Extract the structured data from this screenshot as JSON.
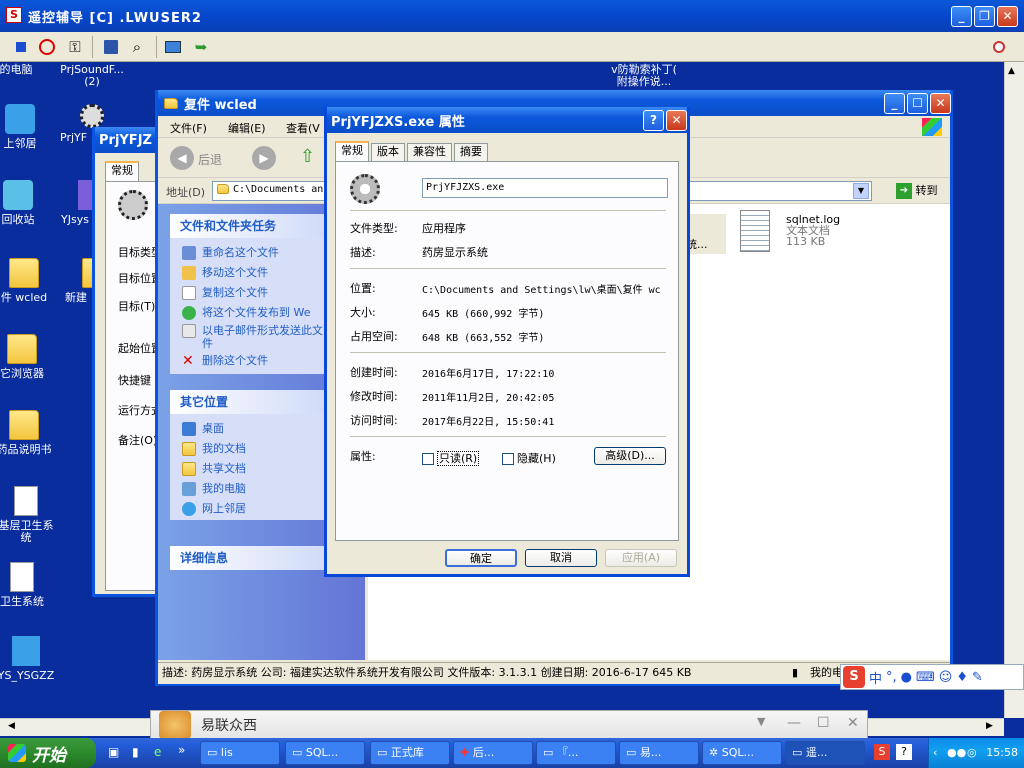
{
  "remote_window": {
    "title": "遥控辅导 [C] .LWUSER2",
    "min": "_",
    "max": "❐",
    "close": "✕"
  },
  "desktop_icons": [
    {
      "label": "的电脑",
      "icon": "computer-icon"
    },
    {
      "label": "PrjSoundF...\n(2)",
      "icon": "gear-icon"
    },
    {
      "label": "上邻居",
      "icon": "network-icon"
    },
    {
      "label": "PrjYF",
      "icon": "gear-icon"
    },
    {
      "label": "回收站",
      "icon": "recycle-icon"
    },
    {
      "label": "YJsys",
      "icon": "app-icon"
    },
    {
      "label": "件 wcled",
      "icon": "folder-icon"
    },
    {
      "label": "新建",
      "icon": "folder-icon"
    },
    {
      "label": "它浏览器",
      "icon": "folder-icon"
    },
    {
      "label": "药品说明书",
      "icon": "folder-icon"
    },
    {
      "label": "基层卫生系统",
      "icon": "shortcut-icon"
    },
    {
      "label": "卫生系统",
      "icon": "shortcut-icon"
    },
    {
      "label": "YS_YSGZZ",
      "icon": "shortcut-icon"
    },
    {
      "label": "v防勒索补丁(\n附操作说...",
      "icon": "doc-icon"
    }
  ],
  "behind_window": {
    "title": "PrjYFJZ",
    "tab": "常规",
    "fields": [
      "目标类型",
      "目标位置",
      "目标(T)",
      "起始位置",
      "快捷键",
      "运行方式",
      "备注(O)"
    ]
  },
  "explorer": {
    "title": "复件 wcled",
    "menu": [
      "文件(F)",
      "编辑(E)",
      "查看(V"
    ],
    "back": "后退",
    "address_label": "地址(D)",
    "address": "C:\\Documents an",
    "go": "转到",
    "tasks_header": "文件和文件夹任务",
    "tasks": [
      {
        "label": "重命名这个文件",
        "icon": "rename-icon"
      },
      {
        "label": "移动这个文件",
        "icon": "move-icon"
      },
      {
        "label": "复制这个文件",
        "icon": "copy-icon"
      },
      {
        "label": "将这个文件发布到 We",
        "icon": "web-icon"
      },
      {
        "label": "以电子邮件形式发送此文件",
        "icon": "email-icon"
      },
      {
        "label": "删除这个文件",
        "icon": "delete-icon"
      }
    ],
    "places_header": "其它位置",
    "places": [
      {
        "label": "桌面",
        "icon": "desktop-icon"
      },
      {
        "label": "我的文档",
        "icon": "folder-icon"
      },
      {
        "label": "共享文档",
        "icon": "folder-icon"
      },
      {
        "label": "我的电脑",
        "icon": "computer-icon"
      },
      {
        "label": "网上邻居",
        "icon": "network-icon"
      }
    ],
    "details_header": "详细信息",
    "file_partial": "统...",
    "file": {
      "name": "sqlnet.log",
      "type": "文本文档",
      "size": "113 KB"
    },
    "status": "描述: 药房显示系统 公司: 福建实达软件系统开发有限公司 文件版本: 3.1.3.1 创建日期: 2016-6-17 645 KB",
    "status_right": "我的电"
  },
  "dialog": {
    "title": "PrjYFJZXS.exe 属性",
    "help": "?",
    "close": "✕",
    "tabs": [
      "常规",
      "版本",
      "兼容性",
      "摘要"
    ],
    "filename": "PrjYFJZXS.exe",
    "type_label": "文件类型:",
    "type_value": "应用程序",
    "desc_label": "描述:",
    "desc_value": "药房显示系统",
    "location_label": "位置:",
    "location_value": "C:\\Documents and Settings\\lw\\桌面\\复件 wc",
    "size_label": "大小:",
    "size_value": "645 KB (660,992 字节)",
    "disk_label": "占用空间:",
    "disk_value": "648 KB (663,552 字节)",
    "created_label": "创建时间:",
    "created_value": "2016年6月17日, 17:22:10",
    "modified_label": "修改时间:",
    "modified_value": "2011年11月2日, 20:42:05",
    "accessed_label": "访问时间:",
    "accessed_value": "2017年6月22日, 15:50:41",
    "attr_label": "属性:",
    "readonly": "只读(R)",
    "hidden": "隐藏(H)",
    "advanced": "高级(D)...",
    "ok": "确定",
    "cancel": "取消",
    "apply": "应用(A)"
  },
  "ime": {
    "logo": "S",
    "mode": "中",
    "punct": "°,"
  },
  "notify": {
    "text": "易联众西",
    "min": "—",
    "max": "☐",
    "close": "✕"
  },
  "taskbar": {
    "start": "开始",
    "tasks": [
      "lis",
      "SQL...",
      "正式库",
      "后...",
      "『...",
      "易...",
      "SQL...",
      "遥..."
    ],
    "clock": "15:58"
  },
  "colors": {
    "title_blue": "#0a58d8",
    "desktop": "#0a2d9e",
    "start_green": "#2d8a2d",
    "link": "#215dc6"
  }
}
